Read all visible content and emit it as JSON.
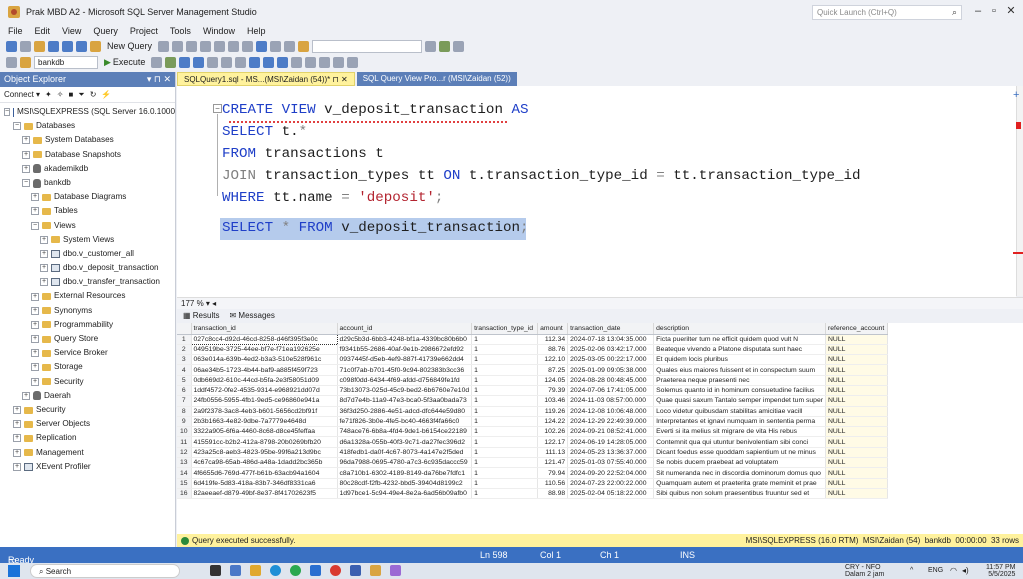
{
  "window": {
    "title": "Prak MBD A2 - Microsoft SQL Server Management Studio",
    "quick_launch": "Quick Launch (Ctrl+Q)"
  },
  "menu": [
    "File",
    "Edit",
    "View",
    "Query",
    "Project",
    "Tools",
    "Window",
    "Help"
  ],
  "toolbar": {
    "new_query": "New Query",
    "database": "bankdb",
    "execute": "Execute"
  },
  "object_explorer": {
    "title": "Object Explorer",
    "connect": "Connect ▾",
    "nodes": [
      {
        "label": "MSI\\SQLEXPRESS (SQL Server 16.0.1000",
        "indent": 0,
        "icon": "server-icon",
        "exp": "−"
      },
      {
        "label": "Databases",
        "indent": 1,
        "icon": "folder-icon",
        "exp": "−"
      },
      {
        "label": "System Databases",
        "indent": 2,
        "icon": "folder-icon",
        "exp": "+"
      },
      {
        "label": "Database Snapshots",
        "indent": 2,
        "icon": "folder-icon",
        "exp": "+"
      },
      {
        "label": "akademikdb",
        "indent": 2,
        "icon": "database-icon",
        "exp": "+"
      },
      {
        "label": "bankdb",
        "indent": 2,
        "icon": "database-icon",
        "exp": "−"
      },
      {
        "label": "Database Diagrams",
        "indent": 3,
        "icon": "folder-icon",
        "exp": "+"
      },
      {
        "label": "Tables",
        "indent": 3,
        "icon": "folder-icon",
        "exp": "+"
      },
      {
        "label": "Views",
        "indent": 3,
        "icon": "folder-icon",
        "exp": "−"
      },
      {
        "label": "System Views",
        "indent": 4,
        "icon": "folder-icon",
        "exp": "+"
      },
      {
        "label": "dbo.v_customer_all",
        "indent": 4,
        "icon": "view-icon",
        "exp": "+"
      },
      {
        "label": "dbo.v_deposit_transaction",
        "indent": 4,
        "icon": "view-icon",
        "exp": "+"
      },
      {
        "label": "dbo.v_transfer_transaction",
        "indent": 4,
        "icon": "view-icon",
        "exp": "+"
      },
      {
        "label": "External Resources",
        "indent": 3,
        "icon": "folder-icon",
        "exp": "+"
      },
      {
        "label": "Synonyms",
        "indent": 3,
        "icon": "folder-icon",
        "exp": "+"
      },
      {
        "label": "Programmability",
        "indent": 3,
        "icon": "folder-icon",
        "exp": "+"
      },
      {
        "label": "Query Store",
        "indent": 3,
        "icon": "folder-icon",
        "exp": "+"
      },
      {
        "label": "Service Broker",
        "indent": 3,
        "icon": "folder-icon",
        "exp": "+"
      },
      {
        "label": "Storage",
        "indent": 3,
        "icon": "folder-icon",
        "exp": "+"
      },
      {
        "label": "Security",
        "indent": 3,
        "icon": "folder-icon",
        "exp": "+"
      },
      {
        "label": "Daerah",
        "indent": 2,
        "icon": "database-icon",
        "exp": "+"
      },
      {
        "label": "Security",
        "indent": 1,
        "icon": "folder-icon",
        "exp": "+"
      },
      {
        "label": "Server Objects",
        "indent": 1,
        "icon": "folder-icon",
        "exp": "+"
      },
      {
        "label": "Replication",
        "indent": 1,
        "icon": "folder-icon",
        "exp": "+"
      },
      {
        "label": "Management",
        "indent": 1,
        "icon": "folder-icon",
        "exp": "+"
      },
      {
        "label": "XEvent Profiler",
        "indent": 1,
        "icon": "profiler-icon",
        "exp": "+"
      }
    ]
  },
  "tabs": [
    {
      "label": "SQLQuery1.sql - MS...(MSI\\Zaidan (54))*",
      "active": true
    },
    {
      "label": "SQL Query View Pro...r (MSI\\Zaidan (52))",
      "active": false
    }
  ],
  "editor": {
    "l1": {
      "k": "CREATE VIEW",
      "t": " v_deposit_transaction ",
      "k2": "AS"
    },
    "l2": {
      "k": "SELECT",
      "t": " t.",
      "g": "*"
    },
    "l3": {
      "k": "FROM",
      "t": " transactions t"
    },
    "l4": {
      "g": "JOIN",
      "t": " transaction_types tt ",
      "k": "ON",
      "t2": " t.transaction_type_id ",
      "g2": "=",
      "t3": " tt.transaction_type_id"
    },
    "l5": {
      "k": "WHERE",
      "t": " tt.name ",
      "g": "=",
      "s": " 'deposit'",
      "g2": ";"
    },
    "l6": {
      "k": "SELECT",
      "g": " * ",
      "k2": "FROM",
      "t": " v_deposit_transaction",
      "g2": ";"
    }
  },
  "zoom": "177 %",
  "results_tabs": [
    "Results",
    "Messages"
  ],
  "grid": {
    "columns": [
      "",
      "transaction_id",
      "account_id",
      "transaction_type_id",
      "amount",
      "transaction_date",
      "description",
      "reference_account"
    ],
    "rows": [
      [
        "1",
        "027c8cc4-d92d-46cd-8258-d46f395f3e0c",
        "d29c5b3d-6bb3-4248-bf1a-4339bc80b6b0",
        "1",
        "112.34",
        "2024-07-18 13:04:35.000",
        "Ficta puerilter tum ne efficit quidem quod vult N",
        "NULL"
      ],
      [
        "2",
        "049519be-3725-44ee-bf7e-f71ea192625e",
        "f9341b55-2686-40af-9e1b-2986672efd92",
        "1",
        "88.76",
        "2025-02-06 03:42:17.000",
        "Beateque vivendo a Platone disputata sunt haec",
        "NULL"
      ],
      [
        "3",
        "063e014a-639b-4ed2-b3a3-510e528f961c",
        "0937445f-d5eb-4ef9-887f-41739e662dd4",
        "1",
        "122.10",
        "2025-03-05 00:22:17.000",
        "Et quidem locis pluribus",
        "NULL"
      ],
      [
        "4",
        "06ae34b5-1723-4b44-baf9-a885f459f723",
        "71c0f7ab-b701-45f0-9c94-802383b3cc36",
        "1",
        "87.25",
        "2025-01-09 09:05:38.000",
        "Quales eius maiores fuissent et in conspectum suum",
        "NULL"
      ],
      [
        "5",
        "0db669d2-610c-44cd-b5fa-2e3f58051d09",
        "c098f0dd-6434-4f69-afdd-d756849fe1fd",
        "1",
        "124.05",
        "2024-08-28 00:48:45.000",
        "Praeterea neque praesenti nec",
        "NULL"
      ],
      [
        "6",
        "1ddf4572-0fe2-4535-9314-e968921dd07d",
        "73b13073-025d-45c9-bed2-6b6760e7e10d",
        "1",
        "79.39",
        "2024-07-06 17:41:05.000",
        "Solemus quanto id in hominum consuetudine facilius",
        "NULL"
      ],
      [
        "7",
        "24fb0556-5955-4fb1-9ed5-ce96860e941a",
        "8d7d7e4b-11a9-47e3-bca0-5f3aa0bada73",
        "1",
        "103.46",
        "2024-11-03 08:57:00.000",
        "Quae quasi saxum Tantalo semper impendet tum super",
        "NULL"
      ],
      [
        "8",
        "2a9f2378-3ac8-4eb3-b601-5656cd2bf91f",
        "36f3d250-2886-4e51-adcd-dfc644e59d80",
        "1",
        "119.26",
        "2024-12-08 10:06:48.000",
        "Loco videtur quibusdam stabilitas amicitiae vacill",
        "NULL"
      ],
      [
        "9",
        "2b3b1663-4e82-9dbe-7a7779e4648d",
        "fe71f826-3b0e-4fe5-bc40-4663f4fa66c0",
        "1",
        "124.22",
        "2024-12-29 22:49:39.000",
        "Interpretantes et ignavi numquam in sententia perma",
        "NULL"
      ],
      [
        "10",
        "3322a905-6f6a-4460-8c68-d8ce45feffaa",
        "748ace76-6b8a-4fd4-9de1-b6154ce22189",
        "1",
        "102.26",
        "2024-09-21 08:52:41.000",
        "Everti si ita melius sit migrare de vita His rebus",
        "NULL"
      ],
      [
        "11",
        "415591cc-b2b2-412a-8798-20b0269bfb20",
        "d6a1328a-055b-40f3-9c71-da27fec396d2",
        "1",
        "122.17",
        "2024-06-19 14:28:05.000",
        "Contemnit qua qui utuntur benivolentiam sibi conci",
        "NULL"
      ],
      [
        "12",
        "423a25c8-aeb3-4823-95be-99f6a213d9bc",
        "418fedb1-da0f-4c67-8073-4a147e2f5ded",
        "1",
        "111.13",
        "2024-05-23 13:36:37.000",
        "Dicant foedus esse quoddam sapientium ut ne minus",
        "NULL"
      ],
      [
        "13",
        "4c67ca98-65ab-486d-a48a-1dadd2bc365b",
        "96da7988-0695-4780-a7c3-6c935daccc59",
        "1",
        "121.47",
        "2025-01-03 07:55:40.000",
        "Se nobis ducem praebeat ad voluptatem",
        "NULL"
      ],
      [
        "14",
        "4f6655d6-769d-477f-b61b-63acb94a1604",
        "c8a710b1-6302-4189-8149-da76be7fdfc1",
        "1",
        "79.94",
        "2024-09-20 22:52:04.000",
        "Sit numeranda nec in discordia dominorum domus quo",
        "NULL"
      ],
      [
        "15",
        "6d419fe-5d83-418a-83b7-346df8331ca6",
        "80c28cdf-f2fb-4232-bbd5-39404d8199c2",
        "1",
        "110.56",
        "2024-07-23 22:00:22.000",
        "Quamquam autem et praeterita grate meminit et prae",
        "NULL"
      ],
      [
        "16",
        "82aeeaef-d879-49bf-8e37-8f41702623f5",
        "1d97bce1-5c94-49e4-8e2a-6ad56b09afb0",
        "1",
        "88.98",
        "2025-02-04 05:18:22.000",
        "Sibi quibus non solum praesentibus fruuntur sed et",
        "NULL"
      ]
    ]
  },
  "status": {
    "message": "Query executed successfully.",
    "server": "MSI\\SQLEXPRESS (16.0 RTM)",
    "user": "MSI\\Zaidan (54)",
    "db": "bankdb",
    "time": "00:00:00",
    "rows": "33 rows"
  },
  "ready": {
    "label": "Ready",
    "ln": "Ln 598",
    "col": "Col 1",
    "ch": "Ch 1",
    "ins": "INS"
  },
  "taskbar": {
    "search": "Search",
    "weather_title": "CRY - NFO",
    "weather_sub": "Dalam 2 jam",
    "lang": "ENG",
    "time": "11:57 PM",
    "date": "5/5/2025"
  },
  "colors": {
    "accent": "#3a70c2",
    "status_yellow": "#fff29d",
    "keyword": "#1f3fc8",
    "string": "#b3232f"
  }
}
